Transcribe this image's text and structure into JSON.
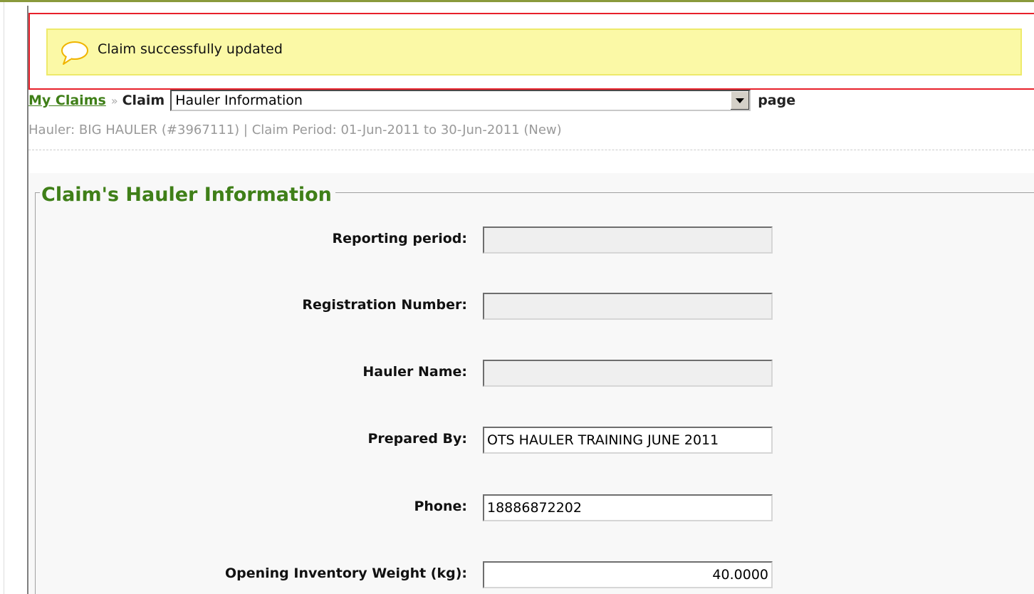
{
  "notice": {
    "message": "Claim successfully updated",
    "icon": "speech-bubble-icon"
  },
  "breadcrumb": {
    "link": "My Claims",
    "separator": "»",
    "label": "Claim",
    "selected_page": "Hauler Information",
    "suffix": "page"
  },
  "subheader": "Hauler: BIG HAULER (#3967111) | Claim Period: 01-Jun-2011 to 30-Jun-2011 (New)",
  "form": {
    "legend": "Claim's Hauler Information",
    "fields": [
      {
        "label": "Reporting period:",
        "value": ""
      },
      {
        "label": "Registration Number:",
        "value": ""
      },
      {
        "label": "Hauler Name:",
        "value": ""
      },
      {
        "label": "Prepared By:",
        "value": "OTS HAULER TRAINING JUNE 2011"
      },
      {
        "label": "Phone:",
        "value": "18886872202"
      },
      {
        "label": "Opening Inventory Weight (kg):",
        "value": "40.0000"
      }
    ]
  },
  "colors": {
    "accent_green": "#3f7f18",
    "notice_bg": "#fbf9a6",
    "alert_border": "#e8202a"
  }
}
